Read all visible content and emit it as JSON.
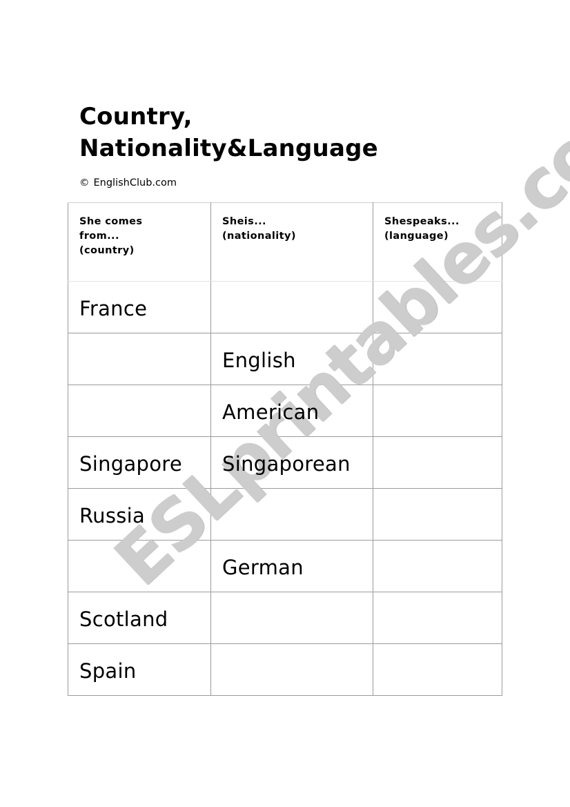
{
  "document": {
    "title_line1": "Country,",
    "title_line2": "Nationality&Language",
    "copyright_symbol": "©",
    "copyright_text": "EnglishClub.com",
    "watermark": "ESLprintables.com"
  },
  "table": {
    "headers": [
      {
        "line1": "She comes",
        "line2": "from...",
        "line3": "(country)"
      },
      {
        "line1": "Sheis...",
        "line2": "(nationality)",
        "line3": ""
      },
      {
        "line1": "Shespeaks...",
        "line2": "(language)",
        "line3": ""
      }
    ],
    "rows": [
      {
        "country": "France",
        "nationality": "",
        "language": ""
      },
      {
        "country": "",
        "nationality": "English",
        "language": ""
      },
      {
        "country": "",
        "nationality": "American",
        "language": ""
      },
      {
        "country": "Singapore",
        "nationality": "Singaporean",
        "language": ""
      },
      {
        "country": "Russia",
        "nationality": "",
        "language": ""
      },
      {
        "country": "",
        "nationality": "German",
        "language": ""
      },
      {
        "country": "Scotland",
        "nationality": "",
        "language": ""
      },
      {
        "country": "Spain",
        "nationality": "",
        "language": ""
      }
    ]
  },
  "colors": {
    "border": "#9a9a9a",
    "watermark": "#cdcdcd",
    "text": "#000000"
  }
}
